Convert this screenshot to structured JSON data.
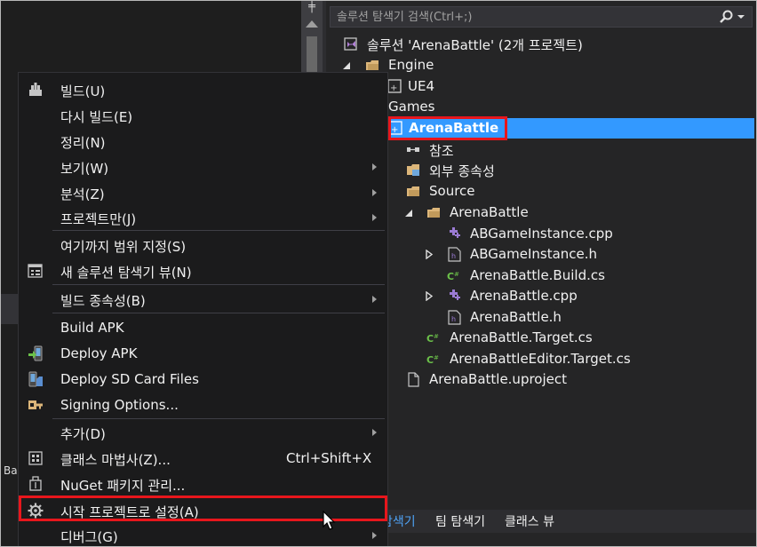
{
  "colors": {
    "accent_selection": "#3399ff",
    "highlight_box": "#e8161c",
    "menu_bg": "#1b1b1c",
    "panel_bg": "#252526"
  },
  "editor": {
    "partial_text": "Ba"
  },
  "search": {
    "placeholder": "솔루션 탐색기 검색(Ctrl+;)",
    "icon": "search-icon"
  },
  "tree": {
    "solution": "솔루션 'ArenaBattle' (2개 프로젝트)",
    "engine_folder": "Engine",
    "ue4_project": "UE4",
    "games_folder": "Games",
    "arenabattle_project": "ArenaBattle",
    "references": "참조",
    "external_deps": "외부 종속성",
    "source_folder": "Source",
    "arenabattle_folder": "ArenaBattle",
    "files": {
      "gameinstance_cpp": "ABGameInstance.cpp",
      "gameinstance_h": "ABGameInstance.h",
      "build_cs": "ArenaBattle.Build.cs",
      "arenabattle_cpp": "ArenaBattle.cpp",
      "arenabattle_h": "ArenaBattle.h",
      "target_cs": "ArenaBattle.Target.cs",
      "editor_target_cs": "ArenaBattleEditor.Target.cs",
      "uproject": "ArenaBattle.uproject"
    }
  },
  "bottom_tabs": {
    "solution_explorer": "탐색기",
    "team_explorer": "팀 탐색기",
    "class_view": "클래스 뷰"
  },
  "menu": {
    "build": "빌드(U)",
    "rebuild": "다시 빌드(E)",
    "clean": "정리(N)",
    "view": "보기(W)",
    "analyze": "분석(Z)",
    "project_only": "프로젝트만(J)",
    "scope_to_this": "여기까지 범위 지정(S)",
    "new_explorer_view": "새 솔루션 탐색기 뷰(N)",
    "build_dependencies": "빌드 종속성(B)",
    "build_apk": "Build APK",
    "deploy_apk": "Deploy APK",
    "deploy_sd": "Deploy SD Card Files",
    "signing": "Signing Options...",
    "add": "추가(D)",
    "class_wizard": "클래스 마법사(Z)...",
    "class_wizard_shortcut": "Ctrl+Shift+X",
    "nuget": "NuGet 패키지 관리...",
    "set_startup": "시작 프로젝트로 설정(A)",
    "debug": "디버그(G)"
  }
}
